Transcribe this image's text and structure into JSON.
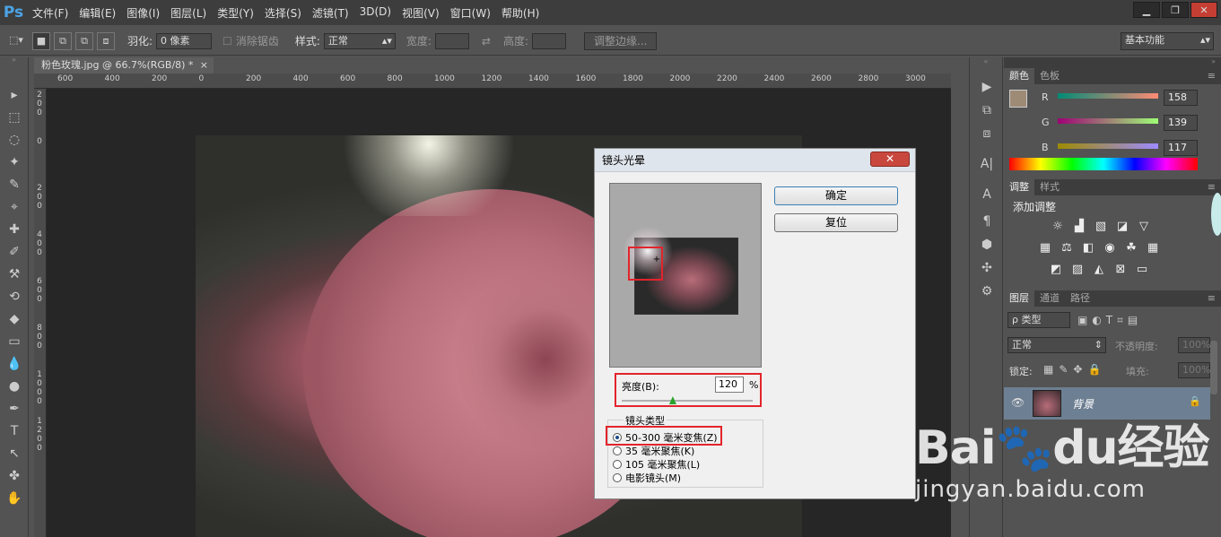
{
  "app": {
    "logo": "Ps"
  },
  "menu": [
    "文件(F)",
    "编辑(E)",
    "图像(I)",
    "图层(L)",
    "类型(Y)",
    "选择(S)",
    "滤镜(T)",
    "3D(D)",
    "视图(V)",
    "窗口(W)",
    "帮助(H)"
  ],
  "window_controls": {
    "minimize": "▁",
    "restore": "❐",
    "close": "✕"
  },
  "options": {
    "feather_label": "羽化:",
    "feather_value": "0 像素",
    "antialias_label": "消除锯齿",
    "style_label": "样式:",
    "style_value": "正常",
    "width_label": "宽度:",
    "height_label": "高度:",
    "refine_edge": "调整边缘...",
    "workspace": "基本功能"
  },
  "document": {
    "tab_title": "粉色玫瑰.jpg @ 66.7%(RGB/8) *",
    "tab_close": "×"
  },
  "ruler": {
    "top": [
      "600",
      "400",
      "200",
      "0",
      "200",
      "400",
      "600",
      "800",
      "1000",
      "1200",
      "1400",
      "1600",
      "1800",
      "2000",
      "2200",
      "2400",
      "2600",
      "2800",
      "3000"
    ],
    "left": [
      "2\n0\n0",
      "0",
      "2\n0\n0",
      "4\n0\n0",
      "6\n0\n0",
      "8\n0\n0",
      "1\n0\n0\n0",
      "1\n2\n0\n0"
    ]
  },
  "tools": [
    "▸",
    "⬚",
    "◌",
    "✦",
    "✎",
    "⌖",
    "✚",
    "✐",
    "⚒",
    "⟲",
    "◆",
    "▭",
    "💧",
    "●",
    "✒",
    "T",
    "↖",
    "✤",
    "✋"
  ],
  "color_panel": {
    "tabs": [
      "颜色",
      "色板"
    ],
    "channels": [
      {
        "name": "R",
        "value": "158"
      },
      {
        "name": "G",
        "value": "139"
      },
      {
        "name": "B",
        "value": "117"
      }
    ],
    "swatch": "#9e8b75"
  },
  "adjust_panel": {
    "tabs": [
      "调整",
      "样式"
    ],
    "title": "添加调整"
  },
  "layers_panel": {
    "tabs": [
      "图层",
      "通道",
      "路径"
    ],
    "filter": "ρ 类型",
    "blend": "正常",
    "opacity_label": "不透明度:",
    "opacity_value": "100%",
    "lock_label": "锁定:",
    "fill_label": "填充:",
    "fill_value": "100%",
    "layer_name": "背景"
  },
  "dialog": {
    "title": "镜头光晕",
    "close": "✕",
    "ok": "确定",
    "reset": "复位",
    "brightness_label": "亮度(B):",
    "brightness_value": "120",
    "brightness_unit": "%",
    "brightness_level": 0.39,
    "lens_type_label": "镜头类型",
    "lens_options": [
      "50-300 毫米变焦(Z)",
      "35 毫米聚焦(K)",
      "105 毫米聚焦(L)",
      "电影镜头(M)"
    ],
    "lens_selected": 0,
    "crosshair": "+"
  },
  "watermark": {
    "logo": "Bai🐾du经验",
    "url": "jingyan.baidu.com"
  },
  "colors": {
    "accent_red": "#e3242b",
    "ps_blue": "#4ba3e6"
  }
}
